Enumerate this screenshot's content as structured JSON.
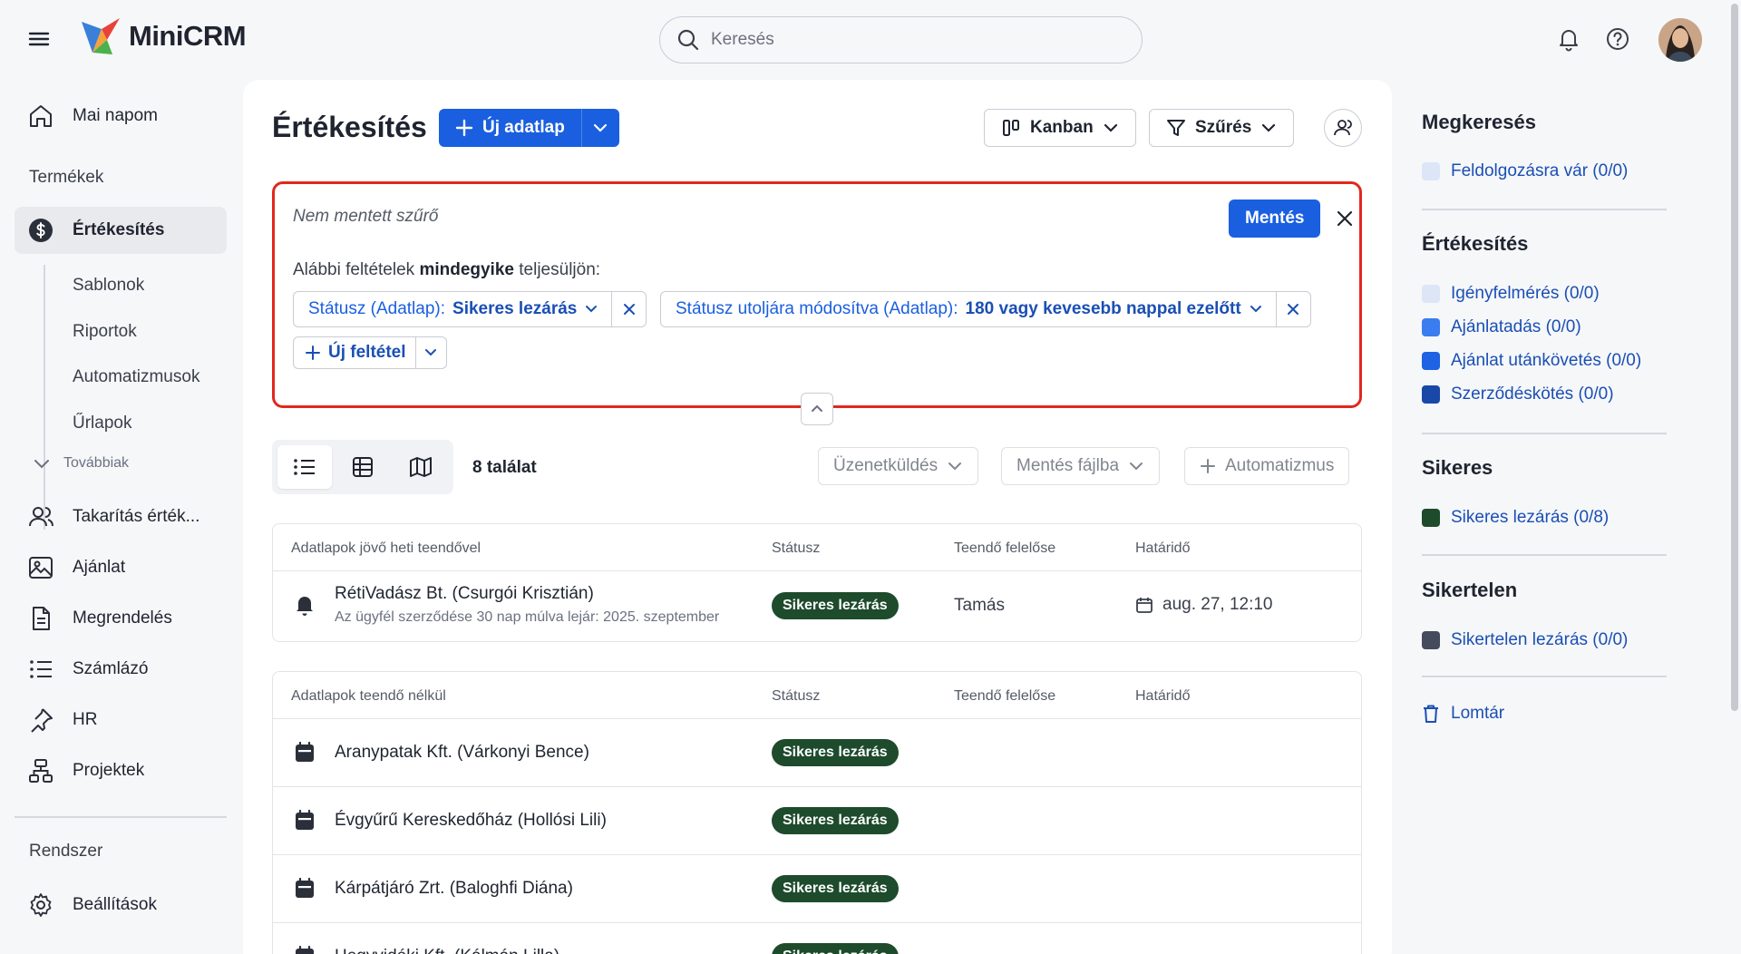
{
  "app": {
    "name": "MiniCRM"
  },
  "search": {
    "placeholder": "Keresés"
  },
  "sidebar": {
    "today": "Mai napom",
    "section_products": "Termékek",
    "active_item": "Értékesítés",
    "sub_items": [
      "Sablonok",
      "Riportok",
      "Automatizmusok",
      "Űrlapok"
    ],
    "more_label": "Továbbiak",
    "items": [
      "Takarítás érték...",
      "Ajánlat",
      "Megrendelés",
      "Számlázó",
      "HR",
      "Projektek"
    ],
    "section_system": "Rendszer",
    "settings": "Beállítások"
  },
  "main": {
    "title": "Értékesítés",
    "new_button": "Új adatlap",
    "view_button": "Kanban",
    "filter_button": "Szűrés",
    "filter": {
      "name": "Nem mentett szűrő",
      "save": "Mentés",
      "conditions_prefix": "Alábbi feltételek",
      "conditions_bold": "mindegyike",
      "conditions_suffix": "teljesüljön:",
      "chips": [
        {
          "field": "Státusz (Adatlap):",
          "value": "Sikeres lezárás"
        },
        {
          "field": "Státusz utoljára módosítva (Adatlap):",
          "value": "180 vagy kevesebb nappal ezelőtt"
        }
      ],
      "add_condition": "Új feltétel"
    },
    "result_count": "8 találat",
    "actions": {
      "messaging": "Üzenetküldés",
      "export": "Mentés fájlba",
      "automation": "Automatizmus"
    },
    "table1": {
      "headers": [
        "Adatlapok jövő heti teendővel",
        "Státusz",
        "Teendő felelőse",
        "Határidő"
      ],
      "rows": [
        {
          "title": "RétiVadász Bt. (Csurgói Krisztián)",
          "subtitle": "Az ügyfél szerződése 30 nap múlva lejár: 2025. szeptember",
          "status": "Sikeres lezárás",
          "owner": "Tamás",
          "deadline": "aug. 27, 12:10"
        }
      ]
    },
    "table2": {
      "headers": [
        "Adatlapok teendő nélkül",
        "Státusz",
        "Teendő felelőse",
        "Határidő"
      ],
      "rows": [
        {
          "title": "Aranypatak Kft. (Várkonyi Bence)",
          "status": "Sikeres lezárás"
        },
        {
          "title": "Évgyűrű Kereskedőház (Hollósi Lili)",
          "status": "Sikeres lezárás"
        },
        {
          "title": "Kárpátjáró Zrt. (Baloghfi Diána)",
          "status": "Sikeres lezárás"
        },
        {
          "title": "Hegyvidéki Kft. (Kálmán Lilla)",
          "status": "Sikeres lezárás"
        }
      ]
    }
  },
  "right_panel": {
    "groups": [
      {
        "title": "Megkeresés",
        "items": [
          {
            "label": "Feldolgozásra vár (0/0)",
            "color": "#dde6f7"
          }
        ]
      },
      {
        "title": "Értékesítés",
        "items": [
          {
            "label": "Igényfelmérés (0/0)",
            "color": "#dde6f7"
          },
          {
            "label": "Ajánlatadás (0/0)",
            "color": "#3b7cf0"
          },
          {
            "label": "Ajánlat utánkövetés (0/0)",
            "color": "#1f62e3"
          },
          {
            "label": "Szerződéskötés (0/0)",
            "color": "#1a48a8"
          }
        ]
      },
      {
        "title": "Sikeres",
        "items": [
          {
            "label": "Sikeres lezárás (0/8)",
            "color": "#1d4b2c"
          }
        ]
      },
      {
        "title": "Sikertelen",
        "items": [
          {
            "label": "Sikertelen lezárás (0/0)",
            "color": "#454b5c"
          }
        ]
      }
    ],
    "trash": "Lomtár"
  },
  "colors": {
    "accent": "#1a5fe0",
    "success": "#1d4b2c",
    "highlight": "#e0281e"
  }
}
